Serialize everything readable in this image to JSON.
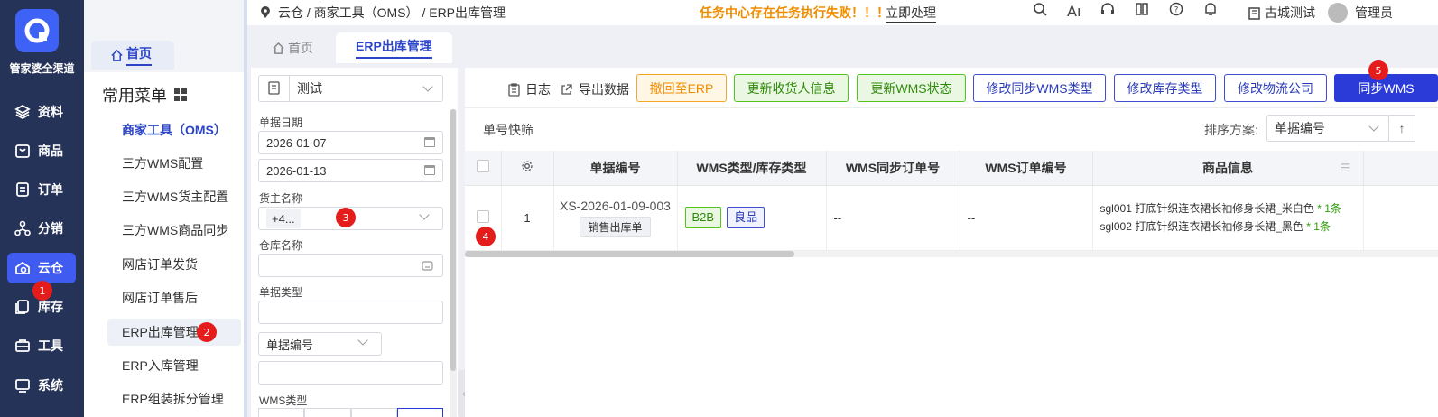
{
  "nav": {
    "logo_text": "管家婆全渠道",
    "items": [
      {
        "label": "资料",
        "icon": "layers-icon"
      },
      {
        "label": "商品",
        "icon": "bag-icon"
      },
      {
        "label": "订单",
        "icon": "document-icon"
      },
      {
        "label": "分销",
        "icon": "network-icon"
      },
      {
        "label": "云仓",
        "icon": "cloud-warehouse-icon"
      },
      {
        "label": "库存",
        "icon": "inventory-icon"
      },
      {
        "label": "工具",
        "icon": "toolbox-icon"
      },
      {
        "label": "系统",
        "icon": "monitor-icon"
      }
    ],
    "active": "云仓"
  },
  "submenu": {
    "home_tab": "首页",
    "favorites_title": "常用菜单",
    "items": [
      "商家工具（OMS）",
      "三方WMS配置",
      "三方WMS货主配置",
      "三方WMS商品同步",
      "网店订单发货",
      "网店订单售后",
      "ERP出库管理",
      "ERP入库管理",
      "ERP组装拆分管理"
    ]
  },
  "topbar": {
    "breadcrumb": "云仓 / 商家工具（OMS） / ERP出库管理",
    "warning": "任务中心存在任务执行失败！！！",
    "warning_link": "立即处理",
    "store": "古城测试",
    "user": "管理员"
  },
  "tabs": [
    {
      "label": "首页",
      "active": false
    },
    {
      "label": "ERP出库管理",
      "active": true
    }
  ],
  "filter": {
    "scheme": "测试",
    "date_label": "单据日期",
    "date_from": "2026-01-07",
    "date_to": "2026-01-13",
    "owner_label": "货主名称",
    "owner_value": "+4...",
    "warehouse_label": "仓库名称",
    "doctype_label": "单据类型",
    "docno_select": "单据编号",
    "wms_type_label": "WMS类型"
  },
  "toolbar": {
    "log": "日志",
    "export": "导出数据",
    "buttons": [
      {
        "label": "撤回至ERP",
        "style": "orange"
      },
      {
        "label": "更新收货人信息",
        "style": "green"
      },
      {
        "label": "更新WMS状态",
        "style": "green"
      },
      {
        "label": "修改同步WMS类型",
        "style": "blue"
      },
      {
        "label": "修改库存类型",
        "style": "blue"
      },
      {
        "label": "修改物流公司",
        "style": "blue"
      },
      {
        "label": "同步WMS",
        "style": "primary"
      }
    ]
  },
  "quick_filter": "单号快筛",
  "sort": {
    "label": "排序方案:",
    "value": "单据编号",
    "dir": "↑"
  },
  "table": {
    "headers": [
      "单据编号",
      "WMS类型/库存类型",
      "WMS同步订单号",
      "WMS订单编号",
      "商品信息"
    ],
    "rows": [
      {
        "index": "1",
        "doc_no": "XS-2026-01-09-003",
        "doc_type": "销售出库单",
        "wms_type": "B2B",
        "stock_type": "良品",
        "wms_sync_no": "--",
        "wms_order_no": "--",
        "goods": [
          {
            "name": "sgl001 打底针织连衣裙长袖修身长裙_米白色",
            "qty": "* 1条"
          },
          {
            "name": "sgl002 打底针织连衣裙长袖修身长裙_黑色",
            "qty": "* 1条"
          }
        ]
      }
    ]
  },
  "badges": [
    "1",
    "2",
    "3",
    "4",
    "5"
  ],
  "colors": {
    "nav_bg": "#263358",
    "accent": "#2b3bd8",
    "warning": "#f08c00",
    "badge": "#e51c1c"
  }
}
